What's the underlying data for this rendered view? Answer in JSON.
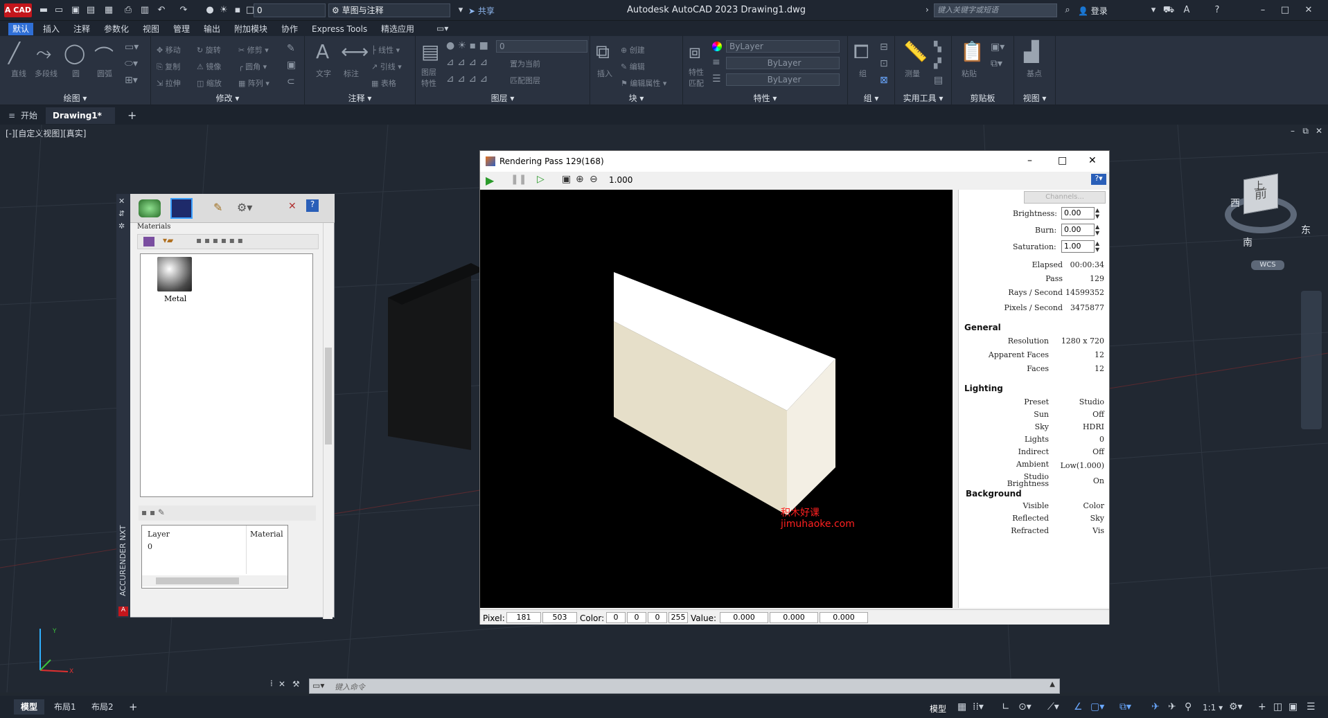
{
  "app": {
    "logo_text": "A CAD",
    "title": "Autodesk AutoCAD 2023    Drawing1.dwg",
    "workspace": "草图与注释",
    "layer_value": "0",
    "share_label": "共享",
    "search_placeholder": "键入关键字或短语",
    "login_label": "登录"
  },
  "menu": [
    "默认",
    "插入",
    "注释",
    "参数化",
    "视图",
    "管理",
    "输出",
    "附加模块",
    "协作",
    "Express Tools",
    "精选应用"
  ],
  "ribbon": {
    "draw": {
      "title": "绘图",
      "line": "直线",
      "polyline": "多段线",
      "circle": "圆",
      "arc": "圆弧"
    },
    "modify": {
      "title": "修改",
      "move": "移动",
      "rotate": "旋转",
      "trim": "修剪",
      "copy": "复制",
      "mirror": "镜像",
      "fillet": "圆角",
      "stretch": "拉伸",
      "scale": "缩放",
      "array": "阵列"
    },
    "annotation": {
      "title": "注释",
      "text": "文字",
      "dimension": "标注",
      "linear": "线性",
      "leader": "引线",
      "table": "表格"
    },
    "layers": {
      "title": "图层",
      "layer_props": "图层特性",
      "current_layer": "0",
      "make_current": "置为当前",
      "match_layer": "匹配图层"
    },
    "block": {
      "title": "块",
      "insert": "插入",
      "create": "创建",
      "edit": "编辑",
      "edit_attr": "编辑属性"
    },
    "properties": {
      "title": "特性",
      "match": "特性匹配",
      "color": "ByLayer",
      "linetype": "ByLayer",
      "lineweight": "ByLayer"
    },
    "groups": {
      "title": "组",
      "group": "组"
    },
    "utilities": {
      "title": "实用工具",
      "measure": "测量"
    },
    "clipboard": {
      "title": "剪贴板",
      "paste": "粘贴"
    },
    "view": {
      "title": "视图",
      "base": "基点"
    }
  },
  "tabs": {
    "start": "开始",
    "drawing": "Drawing1*",
    "add": "+"
  },
  "viewport": {
    "label": "[-][自定义视图][真实]"
  },
  "accurender": {
    "vertical_title": "ACCURENDER NXT",
    "section_title": "Materials",
    "material_name": "Metal",
    "col_layer": "Layer",
    "col_material": "Material",
    "row_layer": "0"
  },
  "render": {
    "title": "Rendering Pass 129(168)",
    "zoom": "1.000",
    "channels": "Channels...",
    "brightness_label": "Brightness:",
    "brightness": "0.00",
    "burn_label": "Burn:",
    "burn": "0.00",
    "saturation_label": "Saturation:",
    "saturation": "1.00",
    "elapsed_label": "Elapsed",
    "elapsed": "00:00:34",
    "pass_label": "Pass",
    "pass": "129",
    "rays_label": "Rays / Second",
    "rays": "14599352",
    "pixels_label": "Pixels / Second",
    "pixels": "3475877",
    "general": "General",
    "resolution_label": "Resolution",
    "resolution": "1280 x 720",
    "apparent_label": "Apparent Faces",
    "apparent": "12",
    "faces_label": "Faces",
    "faces": "12",
    "lighting": "Lighting",
    "preset_label": "Preset",
    "preset": "Studio",
    "sun_label": "Sun",
    "sun": "Off",
    "sky_label": "Sky",
    "sky": "HDRI",
    "lights_label": "Lights",
    "lights": "0",
    "indirect_label": "Indirect",
    "indirect": "Off",
    "ambient_label": "Ambient",
    "ambient": "Low(1.000)",
    "studio_label": "Studio Brightness",
    "studio": "On",
    "background": "Background",
    "visible_label": "Visible",
    "visible": "Color",
    "reflected_label": "Reflected",
    "reflected": "Sky",
    "refracted_label": "Refracted",
    "refracted": "Vis",
    "watermark1": "积木好课",
    "watermark2": "jimuhaoke.com",
    "status": {
      "pixel_label": "Pixel:",
      "px": "181",
      "py": "503",
      "color_label": "Color:",
      "r": "0",
      "g": "0",
      "b": "0",
      "a": "255",
      "value_label": "Value:",
      "v1": "0.000",
      "v2": "0.000",
      "v3": "0.000"
    }
  },
  "viewcube": {
    "top": "上",
    "front": "前",
    "west": "西",
    "east": "东",
    "south": "南",
    "wcs": "WCS"
  },
  "command": {
    "placeholder": "键入命令"
  },
  "bottom": {
    "model": "模型",
    "layout1": "布局1",
    "layout2": "布局2",
    "add": "+",
    "model_btn": "模型",
    "scale": "1:1"
  }
}
